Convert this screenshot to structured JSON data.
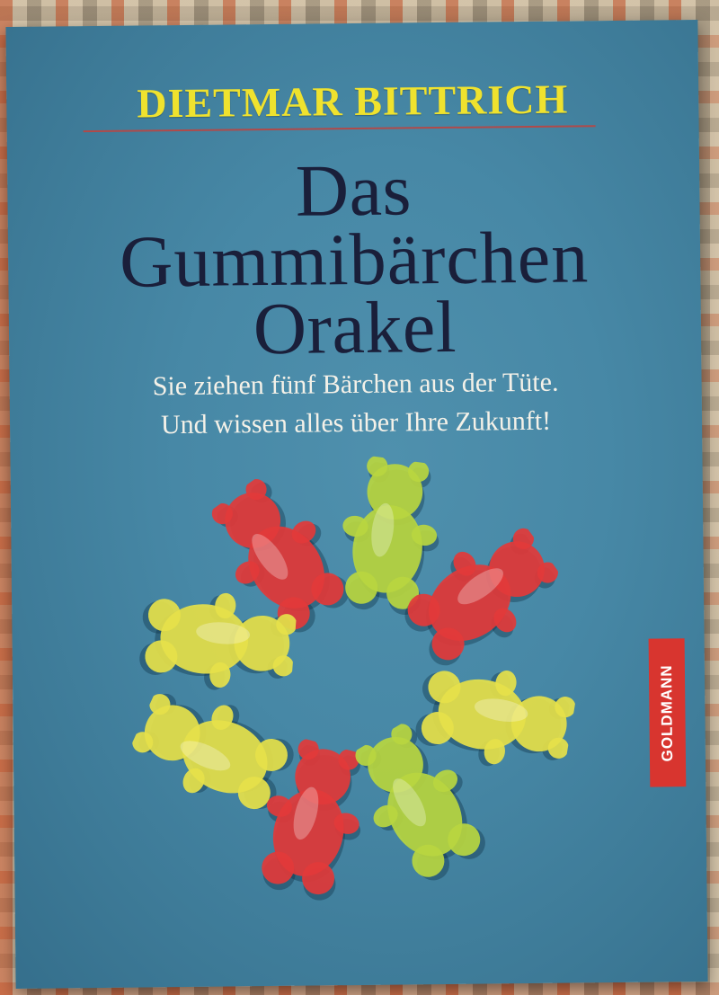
{
  "book": {
    "author": "DIETMAR BITTRICH",
    "title_lines": [
      "Das",
      "Gummibärchen",
      "Orakel"
    ],
    "subtitle_lines": [
      "Sie ziehen fünf Bärchen aus der Tüte.",
      "Und wissen alles über Ihre Zukunft!"
    ],
    "publisher": "GOLDMANN"
  },
  "colors": {
    "cover": "#4788a6",
    "author_text": "#efe22e",
    "title_text": "#1a1f3a",
    "subtitle_text": "#f4f1e8",
    "publisher_badge": "#d8352f",
    "bear_red": "#e23a3a",
    "bear_yellow": "#e6e14a",
    "bear_green": "#b9d640"
  },
  "gummy_bears": [
    {
      "color": "red"
    },
    {
      "color": "green"
    },
    {
      "color": "red"
    },
    {
      "color": "yellow"
    },
    {
      "color": "yellow"
    },
    {
      "color": "yellow"
    },
    {
      "color": "red"
    },
    {
      "color": "green"
    }
  ]
}
